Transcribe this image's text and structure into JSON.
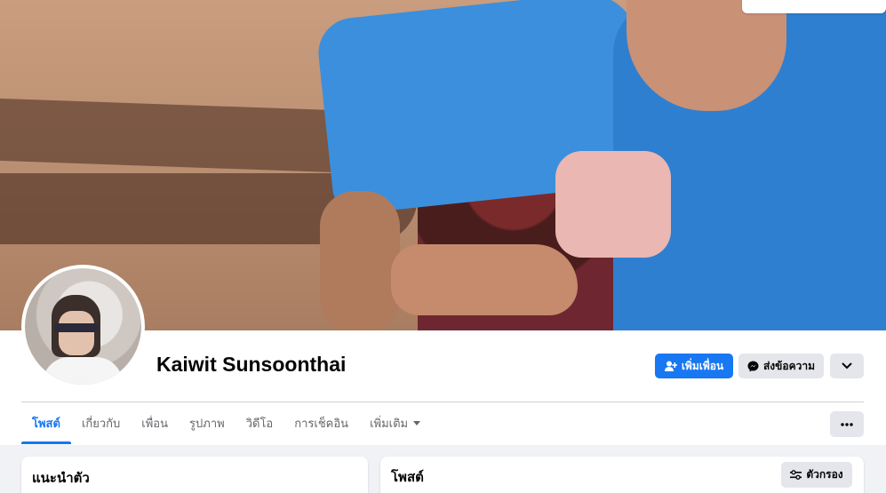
{
  "profile": {
    "name": "Kaiwit Sunsoonthai"
  },
  "actions": {
    "add_friend": "เพิ่มเพื่อน",
    "message": "ส่งข้อความ"
  },
  "tabs": [
    {
      "label": "โพสต์"
    },
    {
      "label": "เกี่ยวกับ"
    },
    {
      "label": "เพื่อน"
    },
    {
      "label": "รูปภาพ"
    },
    {
      "label": "วิดีโอ"
    },
    {
      "label": "การเช็คอิน"
    },
    {
      "label": "เพิ่มเติม"
    }
  ],
  "intro": {
    "title": "แนะนำตัว"
  },
  "posts": {
    "title": "โพสต์",
    "filter_label": "ตัวกรอง"
  },
  "colors": {
    "accent": "#1877f2",
    "button_gray": "#e4e6eb",
    "background": "#f0f2f5"
  },
  "icons": [
    "add-friend-icon",
    "messenger-icon",
    "chevron-down-icon",
    "more-icon",
    "filter-icon",
    "dropdown-caret-icon"
  ]
}
